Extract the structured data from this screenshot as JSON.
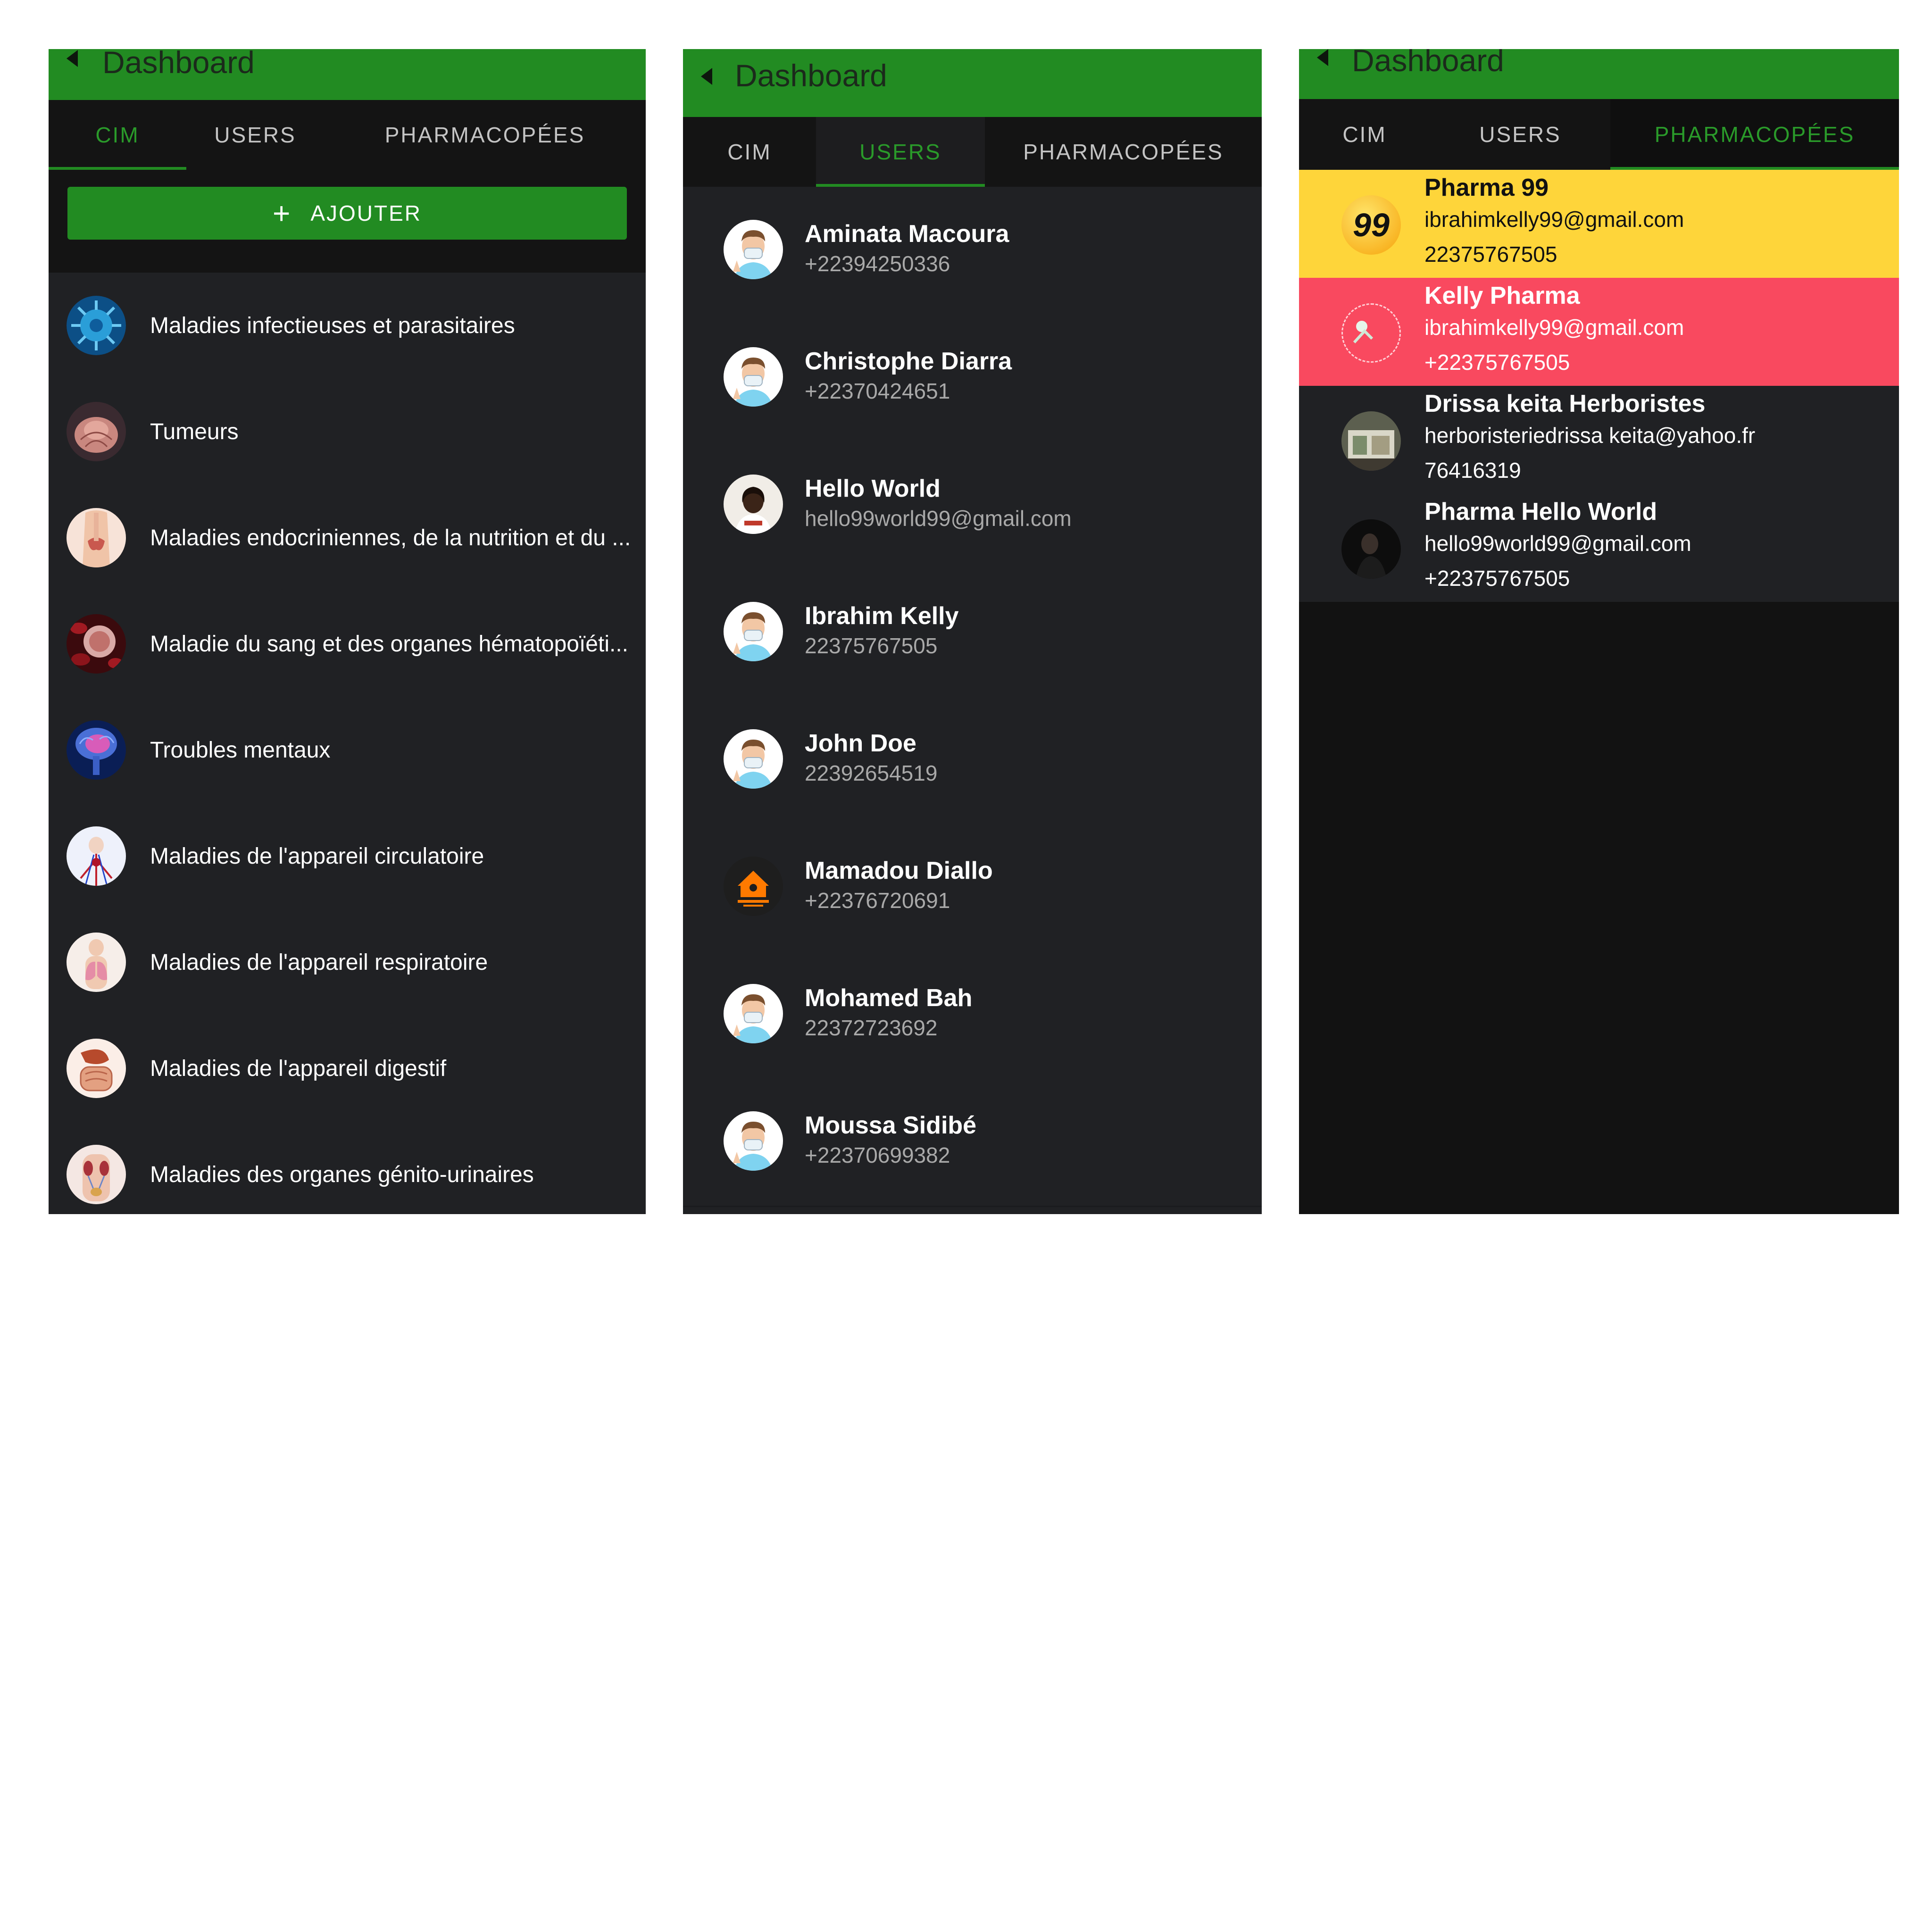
{
  "screens": [
    {
      "appbar": {
        "title": "Dashboard"
      },
      "tabs": [
        "CIM",
        "USERS",
        "PHARMACOPÉES"
      ],
      "active_tab": "CIM",
      "add_button": {
        "label": "AJOUTER"
      },
      "items": [
        {
          "label": "Maladies infectieuses et parasitaires",
          "icon": "virus-icon"
        },
        {
          "label": "Tumeurs",
          "icon": "tumor-icon"
        },
        {
          "label": "Maladies endocriniennes, de la nutrition et du ...",
          "icon": "thyroid-icon"
        },
        {
          "label": "Maladie du sang et des organes hématopoïéti...",
          "icon": "blood-cell-icon"
        },
        {
          "label": "Troubles mentaux",
          "icon": "brain-icon"
        },
        {
          "label": "Maladies de l'appareil circulatoire",
          "icon": "circulatory-icon"
        },
        {
          "label": "Maladies de l'appareil respiratoire",
          "icon": "lungs-icon"
        },
        {
          "label": "Maladies de l'appareil digestif",
          "icon": "digestive-icon"
        },
        {
          "label": "Maladies des organes génito-urinaires",
          "icon": "urinary-icon"
        }
      ]
    },
    {
      "appbar": {
        "title": "Dashboard"
      },
      "tabs": [
        "CIM",
        "USERS",
        "PHARMACOPÉES"
      ],
      "active_tab": "USERS",
      "users": [
        {
          "name": "Aminata Macoura",
          "sub": "+22394250336",
          "avatar": "doctor-avatar-icon"
        },
        {
          "name": "Christophe Diarra",
          "sub": "+22370424651",
          "avatar": "doctor-avatar-icon"
        },
        {
          "name": "Hello World",
          "sub": "hello99world99@gmail.com",
          "avatar": "photo-avatar-icon"
        },
        {
          "name": "Ibrahim Kelly",
          "sub": "22375767505",
          "avatar": "doctor-avatar-icon"
        },
        {
          "name": "John Doe",
          "sub": "22392654519",
          "avatar": "doctor-avatar-icon"
        },
        {
          "name": "Mamadou Diallo",
          "sub": "+22376720691",
          "avatar": "orange-house-logo-icon"
        },
        {
          "name": "Mohamed Bah",
          "sub": "22372723692",
          "avatar": "doctor-avatar-icon"
        },
        {
          "name": "Moussa Sidibé",
          "sub": "+22370699382",
          "avatar": "doctor-avatar-icon"
        }
      ]
    },
    {
      "appbar": {
        "title": "Dashboard"
      },
      "tabs": [
        "CIM",
        "USERS",
        "PHARMACOPÉES"
      ],
      "active_tab": "PHARMACOPÉES",
      "pharmacies": [
        {
          "name": "Pharma 99",
          "email": "ibrahimkelly99@gmail.com",
          "phone": "22375767505",
          "avatar_text": "99",
          "highlight": "#fed53a"
        },
        {
          "name": "Kelly Pharma",
          "email": "ibrahimkelly99@gmail.com",
          "phone": "+22375767505",
          "avatar": "broken-image-icon",
          "highlight": "#f9495f"
        },
        {
          "name": "Drissa keita Herboristes",
          "email": "herboristeriedrissa keita@yahoo.fr",
          "phone": "76416319",
          "avatar": "shop-photo-icon"
        },
        {
          "name": "Pharma Hello World",
          "email": "hello99world99@gmail.com",
          "phone": "+22375767505",
          "avatar": "portrait-photo-icon"
        }
      ]
    }
  ]
}
